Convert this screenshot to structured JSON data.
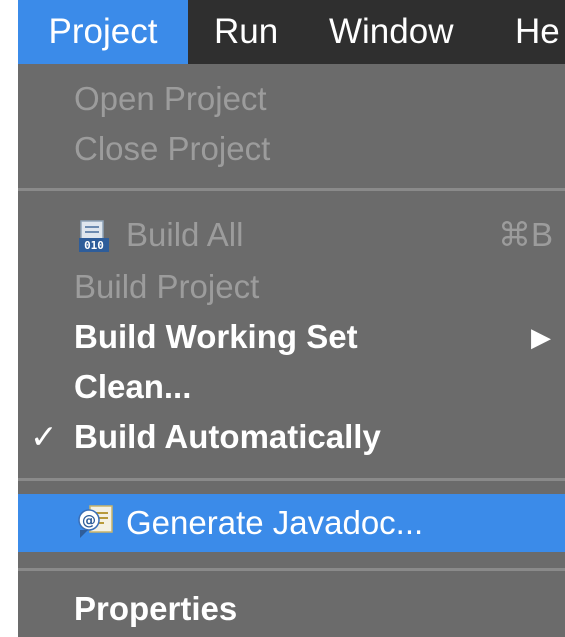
{
  "menubar": {
    "items": [
      {
        "label": "Project",
        "active": true
      },
      {
        "label": "Run"
      },
      {
        "label": "Window"
      },
      {
        "label": "He"
      }
    ]
  },
  "menu": {
    "open_project": "Open Project",
    "close_project": "Close Project",
    "build_all": "Build All",
    "build_all_shortcut": "⌘B",
    "build_project": "Build Project",
    "build_working_set": "Build Working Set",
    "clean": "Clean...",
    "build_automatically": "Build Automatically",
    "generate_javadoc": "Generate Javadoc...",
    "properties": "Properties"
  },
  "glyphs": {
    "checkmark": "✓",
    "submenu_arrow": "▶"
  },
  "colors": {
    "menubar_bg": "#2f2f2f",
    "menu_bg": "#6b6b6b",
    "highlight": "#3b8be9",
    "disabled_text": "#9c9c9c",
    "enabled_text": "#ffffff"
  },
  "icons": {
    "build_all": "binary-file-icon",
    "generate_javadoc": "javadoc-icon"
  }
}
